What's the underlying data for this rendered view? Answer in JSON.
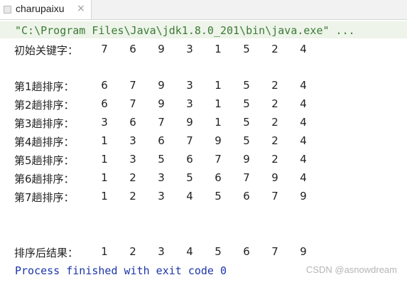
{
  "tab": {
    "title": "charupaixu",
    "close_glyph": "×",
    "icon": "java-file-icon"
  },
  "console": {
    "command": "\"C:\\Program Files\\Java\\jdk1.8.0_201\\bin\\java.exe\" ...",
    "initial": {
      "label": "初始关键字：",
      "values": [
        "7",
        "6",
        "9",
        "3",
        "1",
        "5",
        "2",
        "4"
      ]
    },
    "passes": [
      {
        "label": "第1趟排序：",
        "values": [
          "6",
          "7",
          "9",
          "3",
          "1",
          "5",
          "2",
          "4"
        ]
      },
      {
        "label": "第2趟排序：",
        "values": [
          "6",
          "7",
          "9",
          "3",
          "1",
          "5",
          "2",
          "4"
        ]
      },
      {
        "label": "第3趟排序：",
        "values": [
          "3",
          "6",
          "7",
          "9",
          "1",
          "5",
          "2",
          "4"
        ]
      },
      {
        "label": "第4趟排序：",
        "values": [
          "1",
          "3",
          "6",
          "7",
          "9",
          "5",
          "2",
          "4"
        ]
      },
      {
        "label": "第5趟排序：",
        "values": [
          "1",
          "3",
          "5",
          "6",
          "7",
          "9",
          "2",
          "4"
        ]
      },
      {
        "label": "第6趟排序：",
        "values": [
          "1",
          "2",
          "3",
          "5",
          "6",
          "7",
          "9",
          "4"
        ]
      },
      {
        "label": "第7趟排序：",
        "values": [
          "1",
          "2",
          "3",
          "4",
          "5",
          "6",
          "7",
          "9"
        ]
      }
    ],
    "result": {
      "label": "排序后结果：",
      "values": [
        "1",
        "2",
        "3",
        "4",
        "5",
        "6",
        "7",
        "9"
      ]
    },
    "exit_message": "Process finished with exit code 0"
  },
  "watermark": "CSDN @asnowdream",
  "colors": {
    "command_text": "#3a7a35",
    "command_bg": "#eef4ea",
    "exit_text": "#1b36a8",
    "output_text": "#222222"
  }
}
